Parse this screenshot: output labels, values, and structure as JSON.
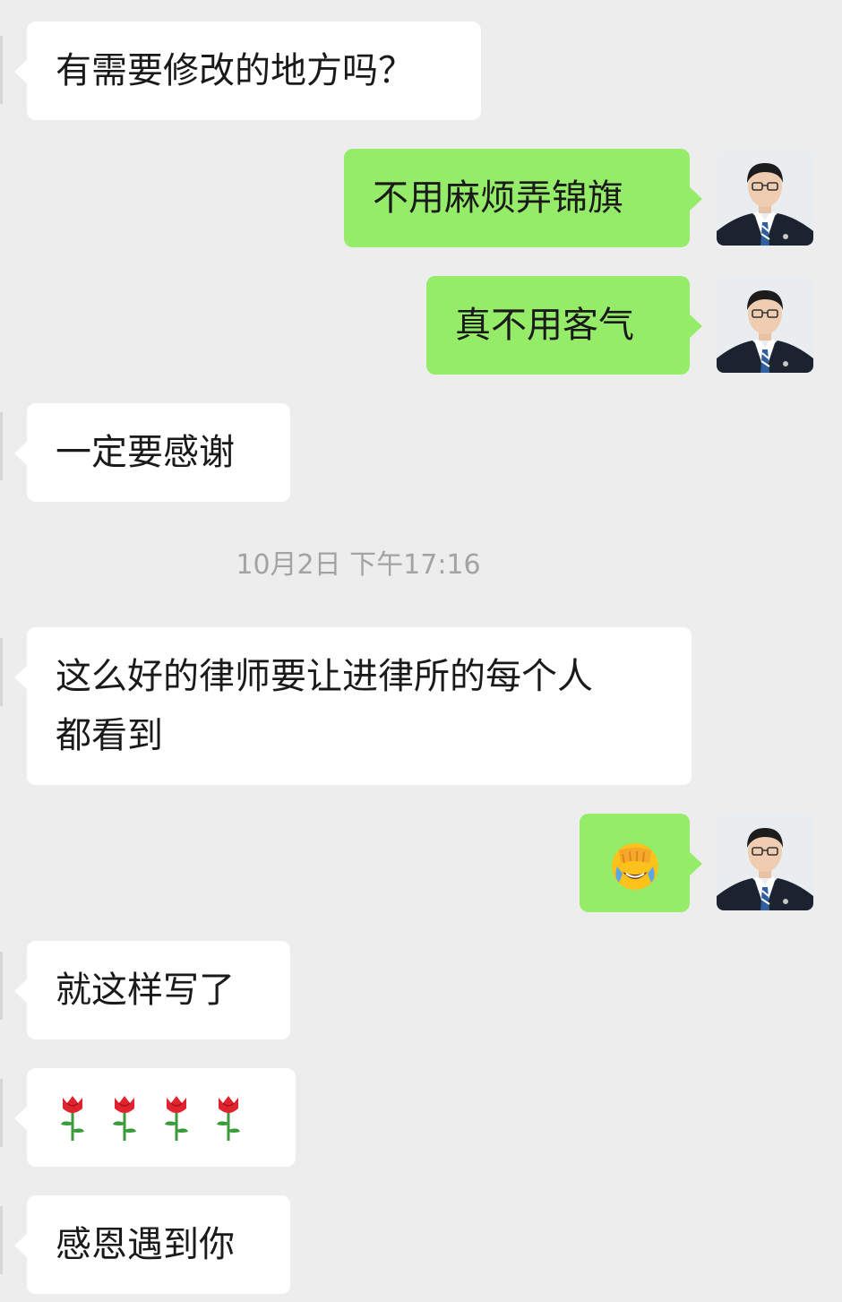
{
  "messages": [
    {
      "id": "m1",
      "side": "incoming",
      "text": "有需要修改的地方吗？"
    },
    {
      "id": "m2",
      "side": "outgoing",
      "text": "不用麻烦弄锦旗"
    },
    {
      "id": "m3",
      "side": "outgoing",
      "text": "真不用客气"
    },
    {
      "id": "m4",
      "side": "incoming",
      "text": "一定要感谢"
    },
    {
      "id": "m5",
      "side": "incoming",
      "lines": [
        "这么好的律师要让进律所的每个人",
        "都看到"
      ]
    },
    {
      "id": "m6",
      "side": "outgoing",
      "emoji": "face-palm-crying-emoji"
    },
    {
      "id": "m7",
      "side": "incoming",
      "text": "就这样写了"
    },
    {
      "id": "m8",
      "side": "incoming",
      "emoji": "rose-emoji",
      "count": 4
    },
    {
      "id": "m9",
      "side": "incoming",
      "text": "感恩遇到你"
    }
  ],
  "timestamp": "10月2日 下午17:16",
  "colors": {
    "background": "#ededed",
    "incoming_bubble": "#ffffff",
    "outgoing_bubble": "#95ec69",
    "timestamp_text": "#a3a3a3"
  },
  "avatar": {
    "icon": "lawyer-avatar-photo"
  }
}
